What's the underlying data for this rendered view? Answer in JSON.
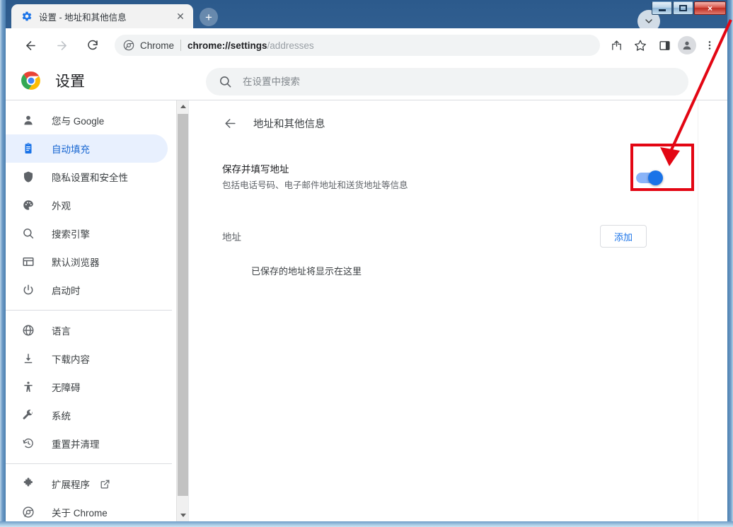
{
  "window": {
    "controls": {
      "minimize_label": "Minimize",
      "maximize_label": "Maximize",
      "close_label": "×"
    }
  },
  "tabstrip": {
    "tab": {
      "favicon": "gear-icon",
      "title": "设置 - 地址和其他信息",
      "close_label": "✕"
    },
    "new_tab_label": "+",
    "tab_search_icon": "chevron-down-icon"
  },
  "toolbar": {
    "back_icon": "arrow-left-icon",
    "forward_icon": "arrow-right-icon",
    "reload_icon": "reload-icon",
    "omnibox": {
      "scheme_label": "Chrome",
      "url_bold": "chrome://settings",
      "url_rest": "/addresses",
      "full_url": "chrome://settings/addresses"
    },
    "share_icon": "share-icon",
    "bookmark_icon": "star-icon",
    "side_panel_icon": "side-panel-icon",
    "avatar_icon": "profile-avatar-icon",
    "menu_icon": "three-dot-menu-icon"
  },
  "settings_header": {
    "logo": "chrome-logo",
    "title": "设置",
    "search": {
      "icon": "search-icon",
      "placeholder": "在设置中搜索",
      "value": ""
    }
  },
  "sidebar": {
    "groups": [
      {
        "items": [
          {
            "label": "您与 Google",
            "icon": "person-icon",
            "active": false
          },
          {
            "label": "自动填充",
            "icon": "clipboard-icon",
            "active": true
          },
          {
            "label": "隐私设置和安全性",
            "icon": "shield-icon",
            "active": false
          },
          {
            "label": "外观",
            "icon": "palette-icon",
            "active": false
          },
          {
            "label": "搜索引擎",
            "icon": "search-icon",
            "active": false
          },
          {
            "label": "默认浏览器",
            "icon": "browser-window-icon",
            "active": false
          },
          {
            "label": "启动时",
            "icon": "power-icon",
            "active": false
          }
        ]
      },
      {
        "items": [
          {
            "label": "语言",
            "icon": "globe-icon",
            "active": false
          },
          {
            "label": "下载内容",
            "icon": "download-icon",
            "active": false
          },
          {
            "label": "无障碍",
            "icon": "accessibility-icon",
            "active": false
          },
          {
            "label": "系统",
            "icon": "wrench-icon",
            "active": false
          },
          {
            "label": "重置并清理",
            "icon": "history-restore-icon",
            "active": false
          }
        ]
      },
      {
        "items": [
          {
            "label": "扩展程序",
            "icon": "puzzle-icon",
            "active": false,
            "external": true
          },
          {
            "label": "关于 Chrome",
            "icon": "chrome-outline-icon",
            "active": false
          }
        ]
      }
    ],
    "scrollbar": {
      "up_icon": "scroll-up-arrow-icon",
      "down_icon": "scroll-down-arrow-icon"
    }
  },
  "main": {
    "back_icon": "arrow-left-icon",
    "page_title": "地址和其他信息",
    "save_fill_setting": {
      "title": "保存并填写地址",
      "subtitle": "包括电话号码、电子邮件地址和送货地址等信息",
      "toggle_on": true
    },
    "addresses_section": {
      "label": "地址",
      "add_button_label": "添加",
      "empty_state": "已保存的地址将显示在这里"
    }
  },
  "annotation": {
    "highlight_color": "#e30613",
    "target": "save-fill-addresses-toggle",
    "shapes": [
      "rectangle",
      "arrow"
    ]
  },
  "colors": {
    "accent_blue": "#1a73e8",
    "toggle_track": "#8ab4f8",
    "active_nav_bg": "#e8f0fe",
    "annotation_red": "#e30613"
  }
}
